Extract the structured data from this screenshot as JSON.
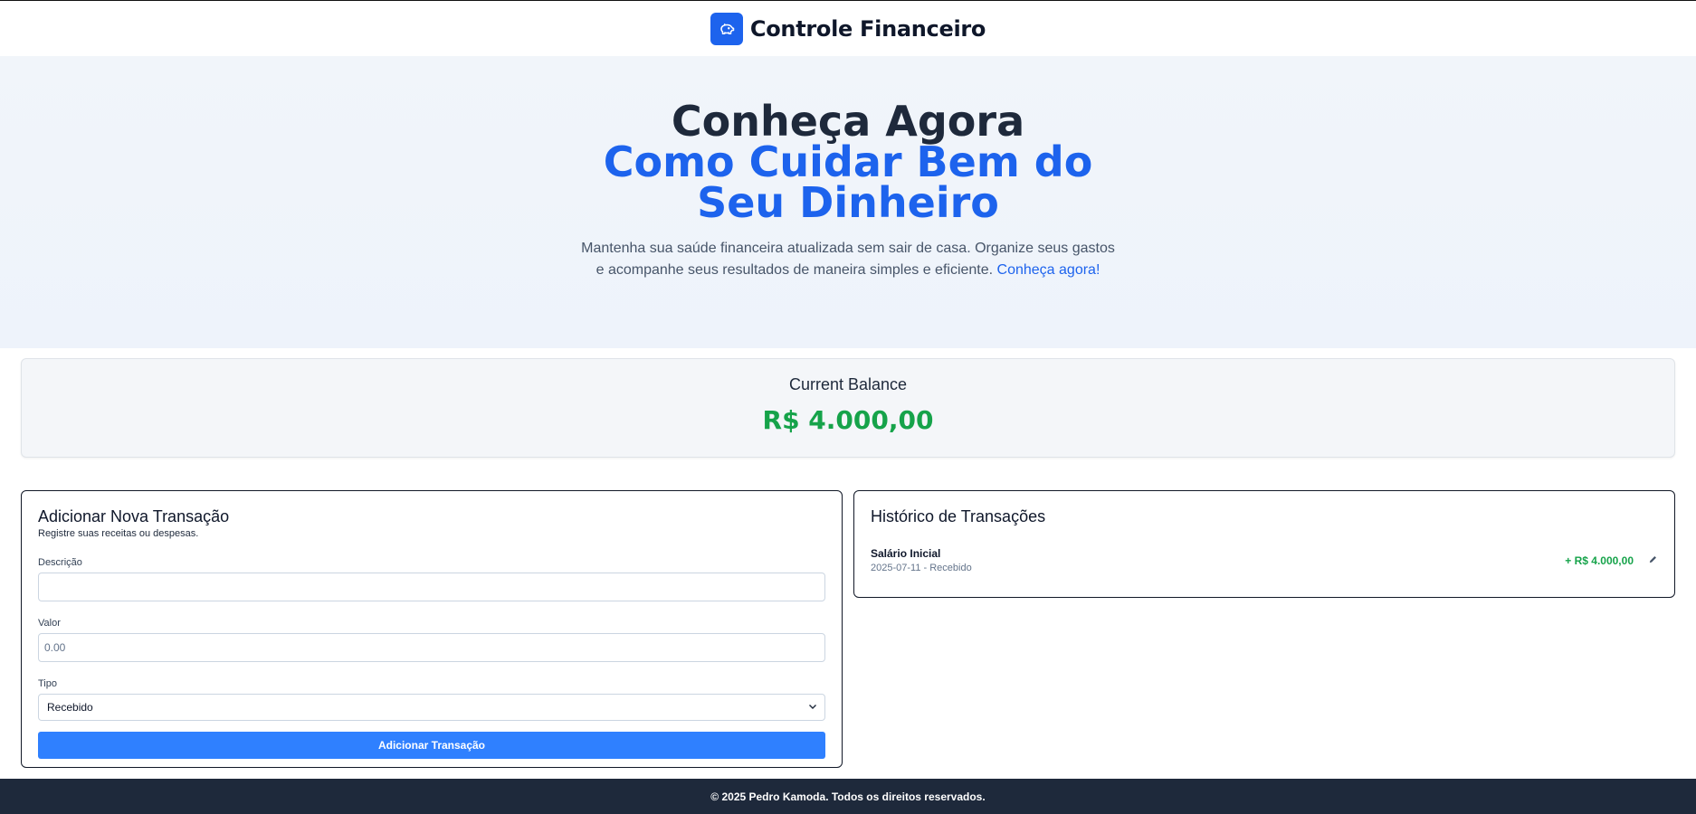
{
  "header": {
    "title": "Controle Financeiro",
    "logo_icon": "piggy-bank-icon",
    "accent": "#1d63ed"
  },
  "hero": {
    "title_line1": "Conheça Agora",
    "title_line2": "Como Cuidar Bem do Seu Dinheiro",
    "description": "Mantenha sua saúde financeira atualizada sem sair de casa. Organize seus gastos e acompanhe seus resultados de maneira simples e eficiente.",
    "link_text": "Conheça agora!"
  },
  "balance": {
    "label": "Current Balance",
    "amount": "R$ 4.000,00",
    "color": "#16a34a"
  },
  "form": {
    "title": "Adicionar Nova Transação",
    "subtitle": "Registre suas receitas ou despesas.",
    "description_label": "Descrição",
    "description_value": "",
    "value_label": "Valor",
    "value_placeholder": "0.00",
    "type_label": "Tipo",
    "type_selected": "Recebido",
    "submit_label": "Adicionar Transação"
  },
  "history": {
    "title": "Histórico de Transações",
    "transactions": [
      {
        "name": "Salário Inicial",
        "meta": "2025-07-11 - Recebido",
        "amount": "+ R$ 4.000,00",
        "edit_icon": "pencil-icon"
      }
    ]
  },
  "footer": {
    "text": "© 2025 Pedro Kamoda. Todos os direitos reservados."
  }
}
